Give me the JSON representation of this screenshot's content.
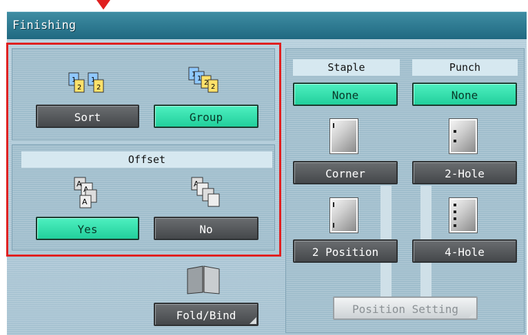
{
  "title": "Finishing",
  "sort_group": {
    "sort_label": "Sort",
    "group_label": "Group",
    "selected": "Group"
  },
  "offset": {
    "header": "Offset",
    "yes_label": "Yes",
    "no_label": "No",
    "selected": "Yes"
  },
  "fold_bind": {
    "label": "Fold/Bind"
  },
  "staple": {
    "header": "Staple",
    "value_label": "None",
    "corner_label": "Corner",
    "two_position_label": "2 Position"
  },
  "punch": {
    "header": "Punch",
    "value_label": "None",
    "two_hole_label": "2-Hole",
    "four_hole_label": "4-Hole"
  },
  "position_setting": {
    "label": "Position Setting",
    "enabled": false
  },
  "colors": {
    "accent_green": "#2bd9a6",
    "title_bar": "#2a7890",
    "highlight_frame": "#e02020"
  }
}
